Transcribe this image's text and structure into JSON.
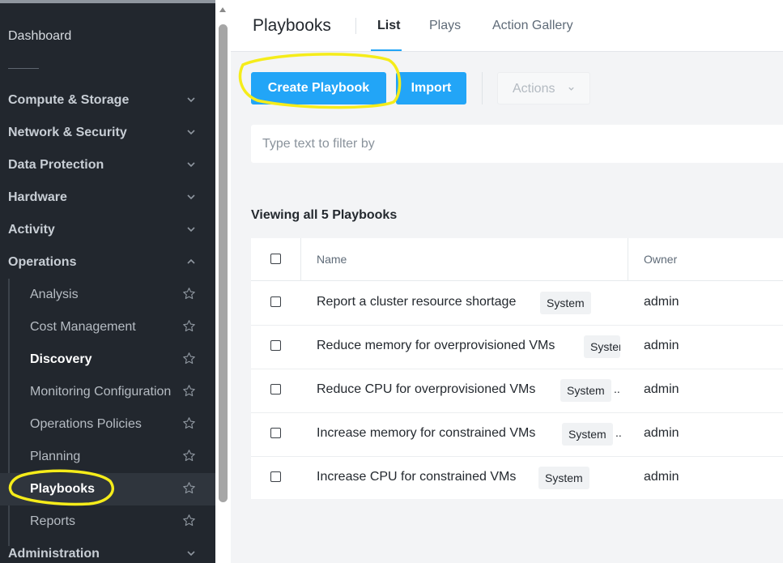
{
  "sidebar": {
    "dashboard": "Dashboard",
    "sections": [
      {
        "label": "Compute & Storage"
      },
      {
        "label": "Network & Security"
      },
      {
        "label": "Data Protection"
      },
      {
        "label": "Hardware"
      },
      {
        "label": "Activity"
      },
      {
        "label": "Operations"
      }
    ],
    "operations_items": [
      {
        "label": "Analysis"
      },
      {
        "label": "Cost Management"
      },
      {
        "label": "Discovery"
      },
      {
        "label": "Monitoring Configuration"
      },
      {
        "label": "Operations Policies"
      },
      {
        "label": "Planning"
      },
      {
        "label": "Playbooks"
      },
      {
        "label": "Reports"
      }
    ],
    "administration": "Administration"
  },
  "header": {
    "title": "Playbooks",
    "tabs": [
      {
        "label": "List",
        "active": true
      },
      {
        "label": "Plays"
      },
      {
        "label": "Action Gallery"
      }
    ]
  },
  "toolbar": {
    "create_label": "Create Playbook",
    "import_label": "Import",
    "actions_label": "Actions"
  },
  "filter": {
    "placeholder": "Type text to filter by",
    "value": ""
  },
  "summary": "Viewing all 5 Playbooks",
  "table": {
    "columns": [
      "Name",
      "Owner"
    ],
    "rows": [
      {
        "name": "Report a cluster resource shortage",
        "badge": "System",
        "owner": "admin"
      },
      {
        "name": "Reduce memory for overprovisioned VMs",
        "badge": "System",
        "owner": "admin"
      },
      {
        "name": "Reduce CPU for overprovisioned VMs",
        "badge": "System",
        "owner": "admin"
      },
      {
        "name": "Increase memory for constrained VMs",
        "badge": "System",
        "owner": "admin"
      },
      {
        "name": "Increase CPU for constrained VMs",
        "badge": "System",
        "owner": "admin"
      }
    ]
  },
  "colors": {
    "accent": "#22a5f7",
    "sidebar_bg": "#22272e",
    "annotation": "#f5ec1a"
  }
}
